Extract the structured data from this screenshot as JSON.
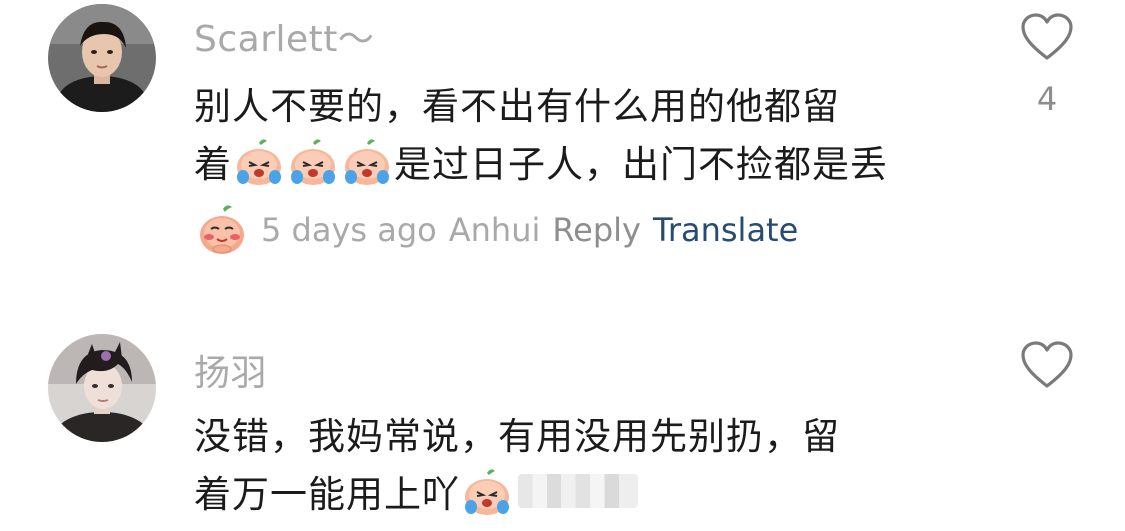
{
  "comments": [
    {
      "username": "Scarlett～",
      "line1": "别人不要的，看不出有什么用的他都留",
      "line2_prefix": "着",
      "line2_text": "是过日子人，出门不捡都是丢",
      "emoji_name": "crying-peach-emoji",
      "sticker_name": "pleading-peach-emoji",
      "time": "5 days ago",
      "location": "Anhui",
      "reply_label": "Reply",
      "translate_label": "Translate",
      "like_count": "4"
    },
    {
      "username": "扬羽",
      "line1": "没错，我妈常说，有用没用先别扔，留",
      "line2_text": "着万一能用上吖",
      "emoji_name": "crying-peach-emoji"
    }
  ],
  "colors": {
    "username": "#a9a9a9",
    "body": "#1b1b1b",
    "meta": "#a9a9a9",
    "reply": "#8e8e8e",
    "translate": "#284b6e",
    "heart": "#7a7a7a"
  }
}
